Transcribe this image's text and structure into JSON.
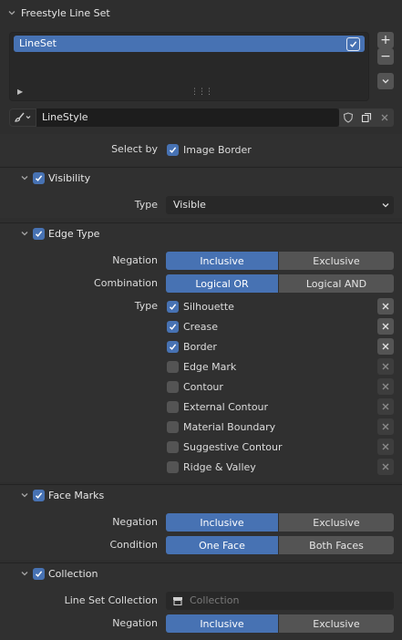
{
  "panel": {
    "title": "Freestyle Line Set"
  },
  "lineset_list": {
    "items": [
      {
        "label": "LineSet",
        "checked": true
      }
    ],
    "add_label": "+",
    "remove_label": "−"
  },
  "linestyle": {
    "name": "LineStyle"
  },
  "select_by": {
    "label": "Select by",
    "option": "Image Border",
    "checked": true
  },
  "visibility": {
    "title": "Visibility",
    "checked": true,
    "type_label": "Type",
    "type_value": "Visible"
  },
  "edge_type": {
    "title": "Edge Type",
    "checked": true,
    "negation_label": "Negation",
    "negation_options": [
      "Inclusive",
      "Exclusive"
    ],
    "negation_selected": "Inclusive",
    "combination_label": "Combination",
    "combination_options": [
      "Logical OR",
      "Logical AND"
    ],
    "combination_selected": "Logical OR",
    "type_label": "Type",
    "types": [
      {
        "label": "Silhouette",
        "checked": true
      },
      {
        "label": "Crease",
        "checked": true
      },
      {
        "label": "Border",
        "checked": true
      },
      {
        "label": "Edge Mark",
        "checked": false
      },
      {
        "label": "Contour",
        "checked": false
      },
      {
        "label": "External Contour",
        "checked": false
      },
      {
        "label": "Material Boundary",
        "checked": false
      },
      {
        "label": "Suggestive Contour",
        "checked": false
      },
      {
        "label": "Ridge & Valley",
        "checked": false
      }
    ]
  },
  "face_marks": {
    "title": "Face Marks",
    "checked": true,
    "negation_label": "Negation",
    "negation_options": [
      "Inclusive",
      "Exclusive"
    ],
    "negation_selected": "Inclusive",
    "condition_label": "Condition",
    "condition_options": [
      "One Face",
      "Both Faces"
    ],
    "condition_selected": "One Face"
  },
  "collection": {
    "title": "Collection",
    "checked": true,
    "lineset_collection_label": "Line Set Collection",
    "collection_placeholder": "Collection",
    "negation_label": "Negation",
    "negation_options": [
      "Inclusive",
      "Exclusive"
    ],
    "negation_selected": "Inclusive"
  },
  "colors": {
    "accent": "#4772b3",
    "panel": "#303030",
    "field": "#282828",
    "button": "#545454"
  }
}
